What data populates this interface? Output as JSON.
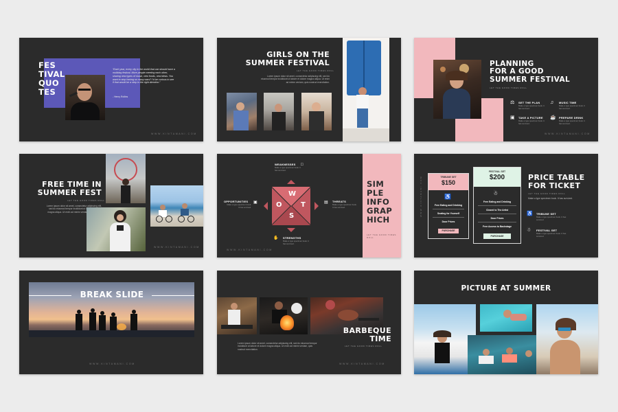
{
  "site_url": "WWW.KINTAMANI.COM",
  "subtitle": "LET THE GOOD TIMES ROLL",
  "lorem": "Lorem ipsum dolor sit amet, consectetur adipiscing elit, sed do eiusmod tempor incididunt ut labore et dolore magna aliqua. Ut enim ad minim veniam, quis nostrud exercitation.",
  "lorem_short": "Make a type specimen book. It has survived.",
  "colors": {
    "background": "#ececec",
    "slide": "#2b2b2b",
    "purple": "#5c58b8",
    "pink": "#f2b8bd",
    "swot_red": "#c0575f",
    "mint": "#dff3e6"
  },
  "slides": {
    "quotes": {
      "title": "FES TIVAL QUO TES",
      "title_lines": [
        "FES",
        "TIVAL",
        "QUO",
        "TES"
      ],
      "quote": "“Each year, every city in the world that can should have a multiday festival. More people meeting each other, sharing new types of music, new foods, new ideas. You want to stop having so many wars? I’d be curious to see if that would be a step in the right direction.”",
      "author": "- Henry Rollins"
    },
    "girls": {
      "title_lines": [
        "GIRLS ON THE",
        "SUMMER FESTIVAL"
      ]
    },
    "planning": {
      "title_lines": [
        "PLANNING",
        "FOR A GOOD",
        "SUMMER FESTIVAL"
      ],
      "items": [
        {
          "label": "SET THE PLAN",
          "icon": "gavel-icon",
          "glyph": "⚖"
        },
        {
          "label": "MUSIC TIME",
          "icon": "headphones-icon",
          "glyph": "♫"
        },
        {
          "label": "TAKE A PICTURE",
          "icon": "camera-icon",
          "glyph": "▣"
        },
        {
          "label": "PREPARE DRINK",
          "icon": "cup-icon",
          "glyph": "☕"
        }
      ]
    },
    "freetime": {
      "title_lines": [
        "FREE TIME IN",
        "SUMMER FEST"
      ]
    },
    "swot": {
      "letters": {
        "w": "W",
        "o": "O",
        "t": "T",
        "s": "S"
      },
      "weaknesses": "WEAKNESSES",
      "opportunities": "OPPORTUNITIES",
      "threats": "THREATS",
      "strengths": "STRENGTHS",
      "title_lines": [
        "SIM",
        "PLE",
        "INFO",
        "GRAP",
        "HICH"
      ]
    },
    "pricing": {
      "title_lines": [
        "PRICE TABLE",
        "FOR TICKET"
      ],
      "tribune": {
        "name": "TRIBUNE SET",
        "price": "$150",
        "features": [
          "Free Eating and Drinking",
          "Seating for Yourself",
          "Door Prizes"
        ],
        "button": "PURCHASE"
      },
      "festival": {
        "name": "FESTIVAL SET",
        "price": "$200",
        "features": [
          "Free Eating and Drinking",
          "Closed to The Artist",
          "Door Prizes",
          "Free Access to Backstage"
        ],
        "button": "PURCHASE"
      },
      "legend": [
        {
          "label": "TRIBUNE SET",
          "icon": "seat-icon"
        },
        {
          "label": "FESTIVAL SET",
          "icon": "dance-icon"
        }
      ]
    },
    "break": {
      "title": "BREAK SLIDE"
    },
    "barbeque": {
      "title_lines": [
        "BARBEQUE",
        "TIME"
      ]
    },
    "picture": {
      "title": "PICTURE AT SUMMER"
    }
  }
}
